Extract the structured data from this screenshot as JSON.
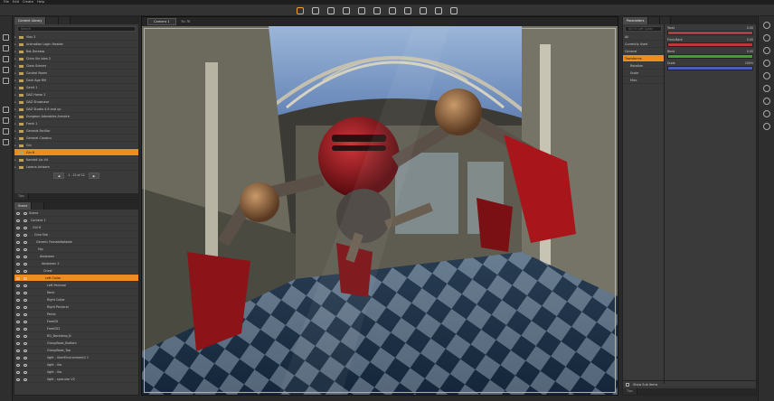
{
  "menu": [
    "File",
    "Edit",
    "Create",
    "Help"
  ],
  "toolbar_icons": [
    "select-icon",
    "rotate-icon",
    "translate-icon",
    "scale-icon",
    "pose-icon",
    "node-icon",
    "joint-icon",
    "geometry-icon",
    "camera-icon",
    "render-icon",
    "light-icon"
  ],
  "left_icons": [
    "new-icon",
    "open-icon",
    "save-icon",
    "merge-icon",
    "undo-icon",
    "redo-icon",
    "render-icon",
    "settings-icon",
    "camera-icon"
  ],
  "content_library": {
    "tab_label": "Content Library",
    "search_placeholder": "Search",
    "page_text": "1 - 12 of 12",
    "items": [
      {
        "label": "Vios 3",
        "highlighted": false
      },
      {
        "label": "Animation Login Header",
        "highlighted": false
      },
      {
        "label": "Bot Dorsess",
        "highlighted": false
      },
      {
        "label": "Chiro Vin Isles 2",
        "highlighted": false
      },
      {
        "label": "Class Scenes",
        "highlighted": false
      },
      {
        "label": "Control Room",
        "highlighted": false
      },
      {
        "label": "Dark Age RM",
        "highlighted": false
      },
      {
        "label": "Genit 1",
        "highlighted": false
      },
      {
        "label": "DAZ Horse 2",
        "highlighted": false
      },
      {
        "label": "DAZ Showcase",
        "highlighted": false
      },
      {
        "label": "DAZ Studio 4.6 and up",
        "highlighted": false
      },
      {
        "label": "Dungeon Adorables Armoire",
        "highlighted": false
      },
      {
        "label": "Fresh 1",
        "highlighted": false
      },
      {
        "label": "Genesis Facillar",
        "highlighted": false
      },
      {
        "label": "General Classics",
        "highlighted": false
      },
      {
        "label": "Gin",
        "highlighted": false
      },
      {
        "label": "Gin 6",
        "highlighted": true
      },
      {
        "label": "Kandall Lip V4",
        "highlighted": false
      },
      {
        "label": "Lorana Artisam",
        "highlighted": false
      }
    ]
  },
  "scene": {
    "tab_label": "Scene",
    "search_placeholder": "Search",
    "items": [
      {
        "label": "Scene",
        "highlighted": false
      },
      {
        "label": "Camera 1",
        "highlighted": false
      },
      {
        "label": "Girl 6",
        "highlighted": false
      },
      {
        "label": "Gina Fab",
        "highlighted": false
      },
      {
        "label": "Generic FemaleNotable",
        "highlighted": false
      },
      {
        "label": "Hip",
        "highlighted": false
      },
      {
        "label": "Abdomen",
        "highlighted": false
      },
      {
        "label": "Abdomen 2",
        "highlighted": false
      },
      {
        "label": "Chest",
        "highlighted": false
      },
      {
        "label": "Left Collar",
        "highlighted": true
      },
      {
        "label": "Left Pectoral",
        "highlighted": false
      },
      {
        "label": "Neck",
        "highlighted": false
      },
      {
        "label": "Right Collar",
        "highlighted": false
      },
      {
        "label": "Right Pectoral",
        "highlighted": false
      },
      {
        "label": "Pelvis",
        "highlighted": false
      },
      {
        "label": "ForeGX",
        "highlighted": false
      },
      {
        "label": "ForeGX2",
        "highlighted": false
      },
      {
        "label": "RG_Backdrop_B",
        "highlighted": false
      },
      {
        "label": "GroupBase_Bottom",
        "highlighted": false
      },
      {
        "label": "GroupBase_Top",
        "highlighted": false
      },
      {
        "label": "light - UberEnvironment2 1",
        "highlighted": false
      },
      {
        "label": "light - Vio",
        "highlighted": false
      },
      {
        "label": "light - Vio",
        "highlighted": false
      },
      {
        "label": "light - specular V2",
        "highlighted": false
      }
    ]
  },
  "viewport": {
    "camera_label": "Camera 1",
    "aux_label": "Rv 76",
    "colors": {
      "sky": "#6a8ec2",
      "floor_dark": "#12243a",
      "floor_light": "#8aa0b6",
      "robot_red": "#9a1a1e",
      "wall": "#6a6658"
    }
  },
  "parameters": {
    "tab_label": "Parameters",
    "selected_node": "Girl 6: Left Collar",
    "tree": [
      {
        "label": "All",
        "highlighted": false
      },
      {
        "label": "Currently Used",
        "highlighted": false
      },
      {
        "label": "General",
        "highlighted": false
      },
      {
        "label": "Transforms",
        "highlighted": true
      },
      {
        "label": "Rotation",
        "highlighted": false
      },
      {
        "label": "Scale",
        "highlighted": false
      },
      {
        "label": "Misc",
        "highlighted": false
      }
    ],
    "sliders": [
      {
        "label": "Twist",
        "value": "0.00",
        "color": "#b83a3a"
      },
      {
        "label": "Front-Back",
        "value": "0.00",
        "color": "#b83a3a"
      },
      {
        "label": "Bend",
        "value": "0.00",
        "color": "#4a9a3a"
      },
      {
        "label": "Scale",
        "value": "100%",
        "color": "#4a5fb8"
      }
    ],
    "footer_checkbox": "Show Sub Items"
  },
  "bottom_tabs": {
    "content": "Tips",
    "scene": "Tips",
    "params": "Tips"
  },
  "accent": "#f08c1c"
}
